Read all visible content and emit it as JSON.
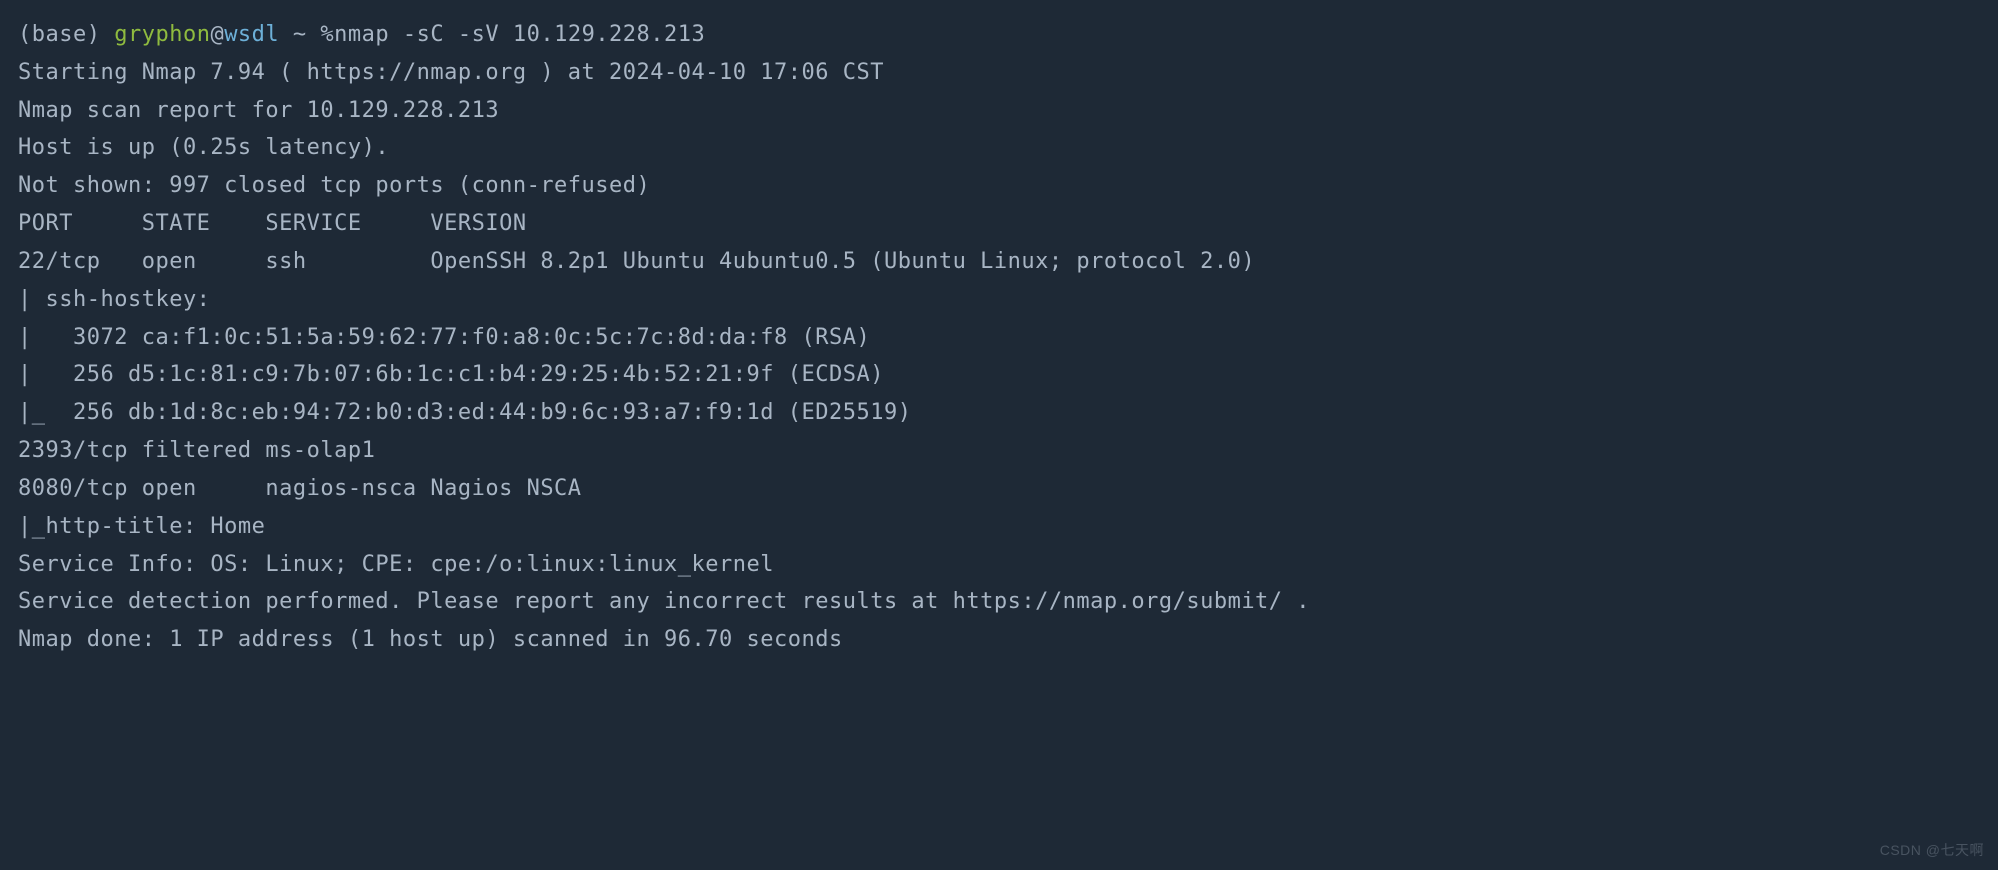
{
  "prompt": {
    "env": "(base) ",
    "user": "gryphon",
    "at": "@",
    "host": "wsdl",
    "path": " ~ %",
    "command": "nmap -sC -sV 10.129.228.213"
  },
  "output": {
    "lines": [
      "Starting Nmap 7.94 ( https://nmap.org ) at 2024-04-10 17:06 CST",
      "Nmap scan report for 10.129.228.213",
      "Host is up (0.25s latency).",
      "Not shown: 997 closed tcp ports (conn-refused)",
      "PORT     STATE    SERVICE     VERSION",
      "22/tcp   open     ssh         OpenSSH 8.2p1 Ubuntu 4ubuntu0.5 (Ubuntu Linux; protocol 2.0)",
      "| ssh-hostkey: ",
      "|   3072 ca:f1:0c:51:5a:59:62:77:f0:a8:0c:5c:7c:8d:da:f8 (RSA)",
      "|   256 d5:1c:81:c9:7b:07:6b:1c:c1:b4:29:25:4b:52:21:9f (ECDSA)",
      "|_  256 db:1d:8c:eb:94:72:b0:d3:ed:44:b9:6c:93:a7:f9:1d (ED25519)",
      "2393/tcp filtered ms-olap1",
      "8080/tcp open     nagios-nsca Nagios NSCA",
      "|_http-title: Home",
      "Service Info: OS: Linux; CPE: cpe:/o:linux:linux_kernel",
      "",
      "Service detection performed. Please report any incorrect results at https://nmap.org/submit/ .",
      "Nmap done: 1 IP address (1 host up) scanned in 96.70 seconds"
    ]
  },
  "watermark": "CSDN @七天啊"
}
